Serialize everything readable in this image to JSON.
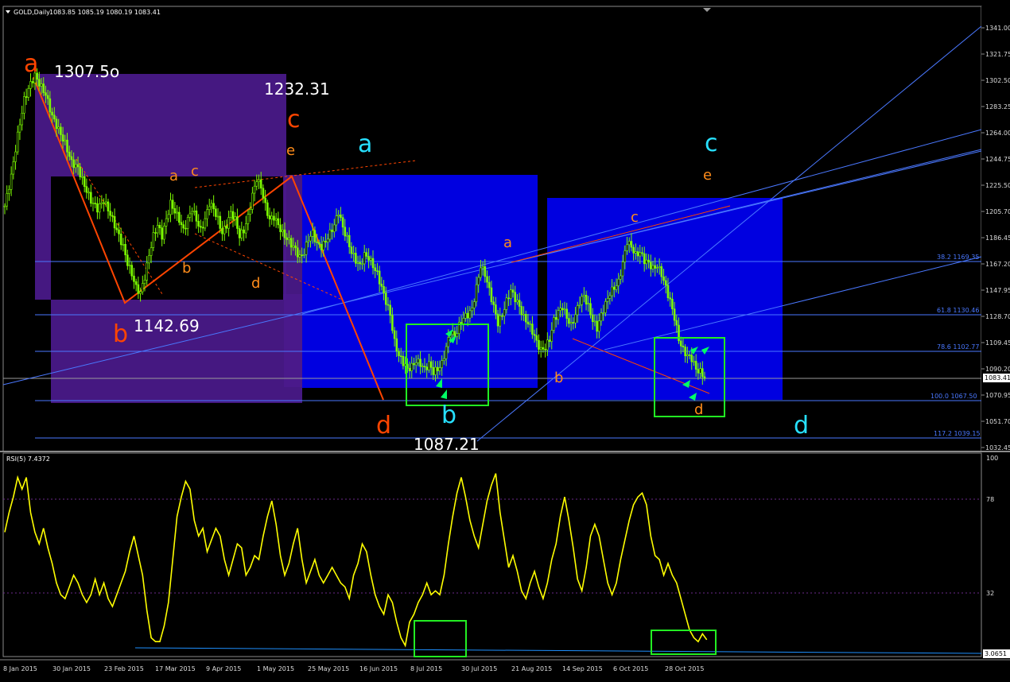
{
  "window": {
    "title": "GOLD,Daily",
    "ohlc": "1083.85 1085.19 1080.19 1083.41",
    "corner_arrow": "▼"
  },
  "indicator": {
    "title": "RSI(5) 7.4372",
    "levels": [
      "100",
      "78",
      "32",
      "3.0651"
    ]
  },
  "colors": {
    "background": "#000000",
    "candles": "#7cfc00",
    "rsi_line": "#ffff00",
    "fib_lines": "#4a78ff",
    "blue_box": "#0000e0",
    "purple_box": "#4b1a8c",
    "green_box": "#22ee22",
    "orange_red": "#ff4500",
    "orange": "#ff8c1a",
    "cyan": "#27e0ff"
  },
  "chart_data": {
    "type": "candlestick",
    "symbol": "GOLD",
    "timeframe": "Daily",
    "ylim": [
      1032.45,
      1341.0
    ],
    "price_ticks": [
      "1341.00",
      "1321.75",
      "1302.50",
      "1283.25",
      "1264.00",
      "1244.75",
      "1225.50",
      "1205.70",
      "1186.45",
      "1167.20",
      "1147.95",
      "1128.70",
      "1109.45",
      "1090.20",
      "1070.95",
      "1051.70",
      "1032.45"
    ],
    "current_price": "1083.41",
    "date_ticks": [
      "8 Jan 2015",
      "30 Jan 2015",
      "23 Feb 2015",
      "17 Mar 2015",
      "9 Apr 2015",
      "1 May 2015",
      "25 May 2015",
      "16 Jun 2015",
      "8 Jul 2015",
      "30 Jul 2015",
      "21 Aug 2015",
      "14 Sep 2015",
      "6 Oct 2015",
      "28 Oct 2015"
    ],
    "price_path": [
      [
        0,
        1210
      ],
      [
        3,
        1232
      ],
      [
        6,
        1262
      ],
      [
        9,
        1288
      ],
      [
        12,
        1300
      ],
      [
        14,
        1306
      ],
      [
        16,
        1300
      ],
      [
        19,
        1292
      ],
      [
        22,
        1276
      ],
      [
        25,
        1266
      ],
      [
        28,
        1256
      ],
      [
        31,
        1242
      ],
      [
        34,
        1238
      ],
      [
        37,
        1225
      ],
      [
        40,
        1214
      ],
      [
        43,
        1208
      ],
      [
        46,
        1214
      ],
      [
        49,
        1204
      ],
      [
        52,
        1192
      ],
      [
        55,
        1180
      ],
      [
        57,
        1168
      ],
      [
        59,
        1160
      ],
      [
        61,
        1150
      ],
      [
        63,
        1146
      ],
      [
        65,
        1158
      ],
      [
        67,
        1174
      ],
      [
        69,
        1188
      ],
      [
        71,
        1196
      ],
      [
        73,
        1188
      ],
      [
        75,
        1200
      ],
      [
        77,
        1212
      ],
      [
        79,
        1206
      ],
      [
        81,
        1200
      ],
      [
        83,
        1192
      ],
      [
        85,
        1200
      ],
      [
        87,
        1208
      ],
      [
        89,
        1200
      ],
      [
        91,
        1192
      ],
      [
        93,
        1200
      ],
      [
        95,
        1212
      ],
      [
        97,
        1208
      ],
      [
        99,
        1200
      ],
      [
        101,
        1190
      ],
      [
        103,
        1196
      ],
      [
        105,
        1205
      ],
      [
        107,
        1200
      ],
      [
        109,
        1188
      ],
      [
        111,
        1192
      ],
      [
        113,
        1202
      ],
      [
        115,
        1218
      ],
      [
        117,
        1230
      ],
      [
        119,
        1224
      ],
      [
        121,
        1210
      ],
      [
        123,
        1200
      ],
      [
        125,
        1202
      ],
      [
        127,
        1196
      ],
      [
        129,
        1190
      ],
      [
        131,
        1186
      ],
      [
        133,
        1182
      ],
      [
        135,
        1178
      ],
      [
        137,
        1172
      ],
      [
        139,
        1176
      ],
      [
        141,
        1186
      ],
      [
        143,
        1190
      ],
      [
        145,
        1182
      ],
      [
        147,
        1180
      ],
      [
        149,
        1184
      ],
      [
        151,
        1190
      ],
      [
        153,
        1196
      ],
      [
        155,
        1206
      ],
      [
        157,
        1194
      ],
      [
        159,
        1186
      ],
      [
        161,
        1176
      ],
      [
        163,
        1170
      ],
      [
        165,
        1166
      ],
      [
        167,
        1174
      ],
      [
        169,
        1172
      ],
      [
        171,
        1166
      ],
      [
        173,
        1160
      ],
      [
        175,
        1150
      ],
      [
        177,
        1140
      ],
      [
        179,
        1130
      ],
      [
        181,
        1110
      ],
      [
        183,
        1100
      ],
      [
        185,
        1095
      ],
      [
        187,
        1090
      ],
      [
        189,
        1092
      ],
      [
        191,
        1096
      ],
      [
        193,
        1094
      ],
      [
        195,
        1090
      ],
      [
        197,
        1094
      ],
      [
        199,
        1088
      ],
      [
        201,
        1090
      ],
      [
        203,
        1094
      ],
      [
        205,
        1106
      ],
      [
        207,
        1118
      ],
      [
        209,
        1114
      ],
      [
        211,
        1122
      ],
      [
        213,
        1128
      ],
      [
        215,
        1130
      ],
      [
        217,
        1134
      ],
      [
        219,
        1150
      ],
      [
        221,
        1166
      ],
      [
        223,
        1160
      ],
      [
        225,
        1148
      ],
      [
        227,
        1136
      ],
      [
        229,
        1124
      ],
      [
        231,
        1130
      ],
      [
        233,
        1140
      ],
      [
        235,
        1148
      ],
      [
        237,
        1142
      ],
      [
        239,
        1136
      ],
      [
        241,
        1128
      ],
      [
        243,
        1124
      ],
      [
        245,
        1118
      ],
      [
        247,
        1110
      ],
      [
        249,
        1104
      ],
      [
        251,
        1106
      ],
      [
        253,
        1112
      ],
      [
        255,
        1126
      ],
      [
        257,
        1132
      ],
      [
        259,
        1136
      ],
      [
        261,
        1128
      ],
      [
        263,
        1122
      ],
      [
        265,
        1130
      ],
      [
        267,
        1140
      ],
      [
        269,
        1144
      ],
      [
        271,
        1136
      ],
      [
        273,
        1126
      ],
      [
        275,
        1120
      ],
      [
        277,
        1130
      ],
      [
        279,
        1138
      ],
      [
        281,
        1146
      ],
      [
        283,
        1150
      ],
      [
        285,
        1154
      ],
      [
        287,
        1168
      ],
      [
        289,
        1184
      ],
      [
        291,
        1180
      ],
      [
        293,
        1174
      ],
      [
        295,
        1176
      ],
      [
        297,
        1170
      ],
      [
        299,
        1168
      ],
      [
        301,
        1164
      ],
      [
        303,
        1166
      ],
      [
        305,
        1160
      ],
      [
        307,
        1150
      ],
      [
        309,
        1140
      ],
      [
        311,
        1128
      ],
      [
        313,
        1112
      ],
      [
        315,
        1104
      ],
      [
        317,
        1100
      ],
      [
        319,
        1098
      ],
      [
        321,
        1090
      ],
      [
        323,
        1088
      ],
      [
        325,
        1084
      ]
    ],
    "rsi_path": [
      [
        0,
        62
      ],
      [
        2,
        72
      ],
      [
        4,
        80
      ],
      [
        6,
        90
      ],
      [
        8,
        84
      ],
      [
        10,
        90
      ],
      [
        12,
        72
      ],
      [
        14,
        62
      ],
      [
        16,
        56
      ],
      [
        18,
        64
      ],
      [
        20,
        54
      ],
      [
        22,
        46
      ],
      [
        24,
        36
      ],
      [
        26,
        30
      ],
      [
        28,
        28
      ],
      [
        30,
        34
      ],
      [
        32,
        40
      ],
      [
        34,
        36
      ],
      [
        36,
        30
      ],
      [
        38,
        26
      ],
      [
        40,
        30
      ],
      [
        42,
        38
      ],
      [
        44,
        30
      ],
      [
        46,
        36
      ],
      [
        48,
        28
      ],
      [
        50,
        24
      ],
      [
        52,
        30
      ],
      [
        54,
        36
      ],
      [
        56,
        42
      ],
      [
        58,
        52
      ],
      [
        60,
        60
      ],
      [
        62,
        50
      ],
      [
        64,
        40
      ],
      [
        66,
        22
      ],
      [
        68,
        8
      ],
      [
        70,
        6
      ],
      [
        72,
        6
      ],
      [
        74,
        14
      ],
      [
        76,
        26
      ],
      [
        78,
        48
      ],
      [
        80,
        70
      ],
      [
        82,
        80
      ],
      [
        84,
        88
      ],
      [
        86,
        84
      ],
      [
        88,
        68
      ],
      [
        90,
        60
      ],
      [
        92,
        64
      ],
      [
        94,
        52
      ],
      [
        96,
        58
      ],
      [
        98,
        64
      ],
      [
        100,
        60
      ],
      [
        102,
        48
      ],
      [
        104,
        40
      ],
      [
        106,
        48
      ],
      [
        108,
        56
      ],
      [
        110,
        54
      ],
      [
        112,
        40
      ],
      [
        114,
        44
      ],
      [
        116,
        50
      ],
      [
        118,
        48
      ],
      [
        120,
        60
      ],
      [
        122,
        70
      ],
      [
        124,
        78
      ],
      [
        126,
        66
      ],
      [
        128,
        50
      ],
      [
        130,
        40
      ],
      [
        132,
        46
      ],
      [
        134,
        56
      ],
      [
        136,
        64
      ],
      [
        138,
        48
      ],
      [
        140,
        36
      ],
      [
        142,
        42
      ],
      [
        144,
        48
      ],
      [
        146,
        40
      ],
      [
        148,
        36
      ],
      [
        150,
        40
      ],
      [
        152,
        44
      ],
      [
        154,
        40
      ],
      [
        156,
        36
      ],
      [
        158,
        34
      ],
      [
        160,
        28
      ],
      [
        162,
        40
      ],
      [
        164,
        46
      ],
      [
        166,
        56
      ],
      [
        168,
        52
      ],
      [
        170,
        40
      ],
      [
        172,
        30
      ],
      [
        174,
        24
      ],
      [
        176,
        20
      ],
      [
        178,
        30
      ],
      [
        180,
        26
      ],
      [
        182,
        16
      ],
      [
        184,
        8
      ],
      [
        186,
        4
      ],
      [
        188,
        16
      ],
      [
        190,
        20
      ],
      [
        192,
        26
      ],
      [
        194,
        30
      ],
      [
        196,
        36
      ],
      [
        198,
        30
      ],
      [
        200,
        32
      ],
      [
        202,
        30
      ],
      [
        204,
        40
      ],
      [
        206,
        56
      ],
      [
        208,
        70
      ],
      [
        210,
        82
      ],
      [
        212,
        90
      ],
      [
        214,
        80
      ],
      [
        216,
        68
      ],
      [
        218,
        60
      ],
      [
        220,
        54
      ],
      [
        222,
        66
      ],
      [
        224,
        78
      ],
      [
        226,
        86
      ],
      [
        228,
        92
      ],
      [
        230,
        72
      ],
      [
        232,
        58
      ],
      [
        234,
        44
      ],
      [
        236,
        50
      ],
      [
        238,
        42
      ],
      [
        240,
        32
      ],
      [
        242,
        28
      ],
      [
        244,
        36
      ],
      [
        246,
        42
      ],
      [
        248,
        34
      ],
      [
        250,
        28
      ],
      [
        252,
        36
      ],
      [
        254,
        48
      ],
      [
        256,
        56
      ],
      [
        258,
        70
      ],
      [
        260,
        80
      ],
      [
        262,
        68
      ],
      [
        264,
        54
      ],
      [
        266,
        38
      ],
      [
        268,
        32
      ],
      [
        270,
        44
      ],
      [
        272,
        60
      ],
      [
        274,
        66
      ],
      [
        276,
        60
      ],
      [
        278,
        48
      ],
      [
        280,
        36
      ],
      [
        282,
        30
      ],
      [
        284,
        36
      ],
      [
        286,
        48
      ],
      [
        288,
        58
      ],
      [
        290,
        68
      ],
      [
        292,
        76
      ],
      [
        294,
        80
      ],
      [
        296,
        82
      ],
      [
        298,
        76
      ],
      [
        300,
        60
      ],
      [
        302,
        50
      ],
      [
        304,
        48
      ],
      [
        306,
        40
      ],
      [
        308,
        46
      ],
      [
        310,
        40
      ],
      [
        312,
        36
      ],
      [
        314,
        28
      ],
      [
        316,
        20
      ],
      [
        318,
        12
      ],
      [
        320,
        8
      ],
      [
        322,
        6
      ],
      [
        324,
        10
      ],
      [
        326,
        7
      ]
    ],
    "fib_levels": [
      {
        "label": "38.2  1169.35"
      },
      {
        "label": "61.8  1130.46"
      },
      {
        "label": "78.6  1102.77"
      },
      {
        "label": "100.0  1067.50"
      },
      {
        "label": "117.2  1039.15"
      }
    ],
    "price_labels": [
      "1307.5o",
      "1232.31",
      "1142.69",
      "1087.21"
    ],
    "wave_labels": {
      "red": [
        "a",
        "b",
        "c",
        "d"
      ],
      "orange": [
        "a",
        "c",
        "b",
        "d",
        "e",
        "a",
        "b",
        "c",
        "e",
        "d"
      ],
      "cyan": [
        "a",
        "b",
        "c",
        "d"
      ]
    }
  }
}
